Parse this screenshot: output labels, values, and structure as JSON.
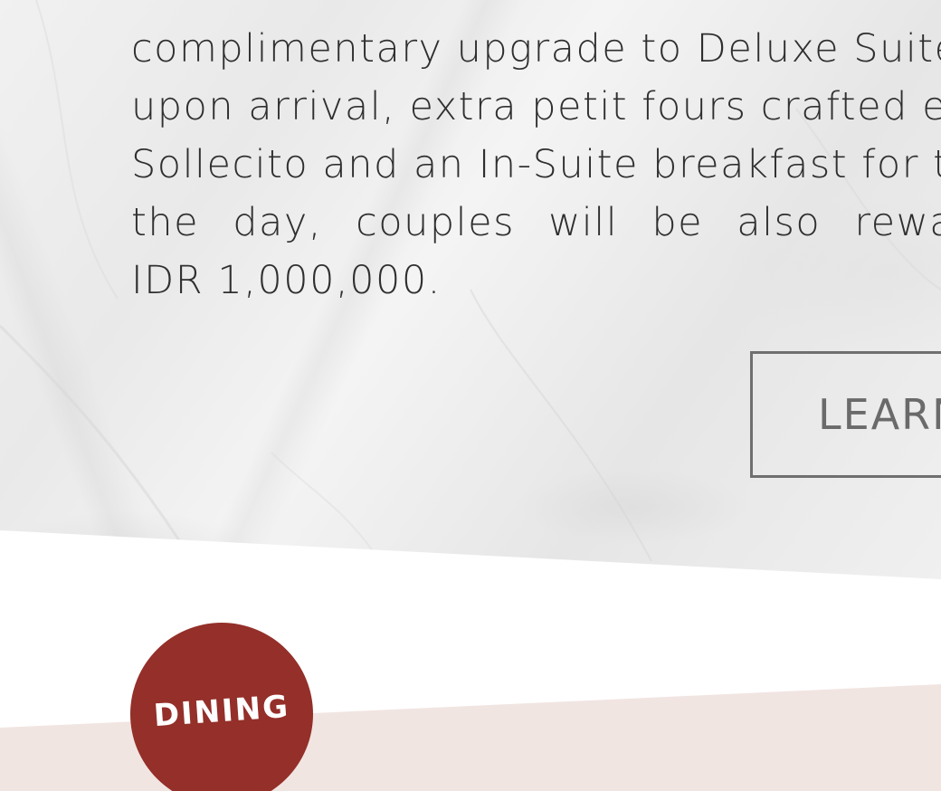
{
  "promo": {
    "lines": [
      "complimentary upgrade to Deluxe Suite,",
      "upon arrival, extra petit fours crafted es",
      "Sollecito and an In-Suite breakfast for tw",
      "the day, couples will be also reward",
      "IDR 1,000,000."
    ]
  },
  "cta": {
    "label": "LEARN"
  },
  "badge": {
    "label": "DINING",
    "color": "#942f29"
  },
  "colors": {
    "text": "#2f2f2f",
    "button_border": "#6f6f6f",
    "band": "#f1e5e2"
  }
}
